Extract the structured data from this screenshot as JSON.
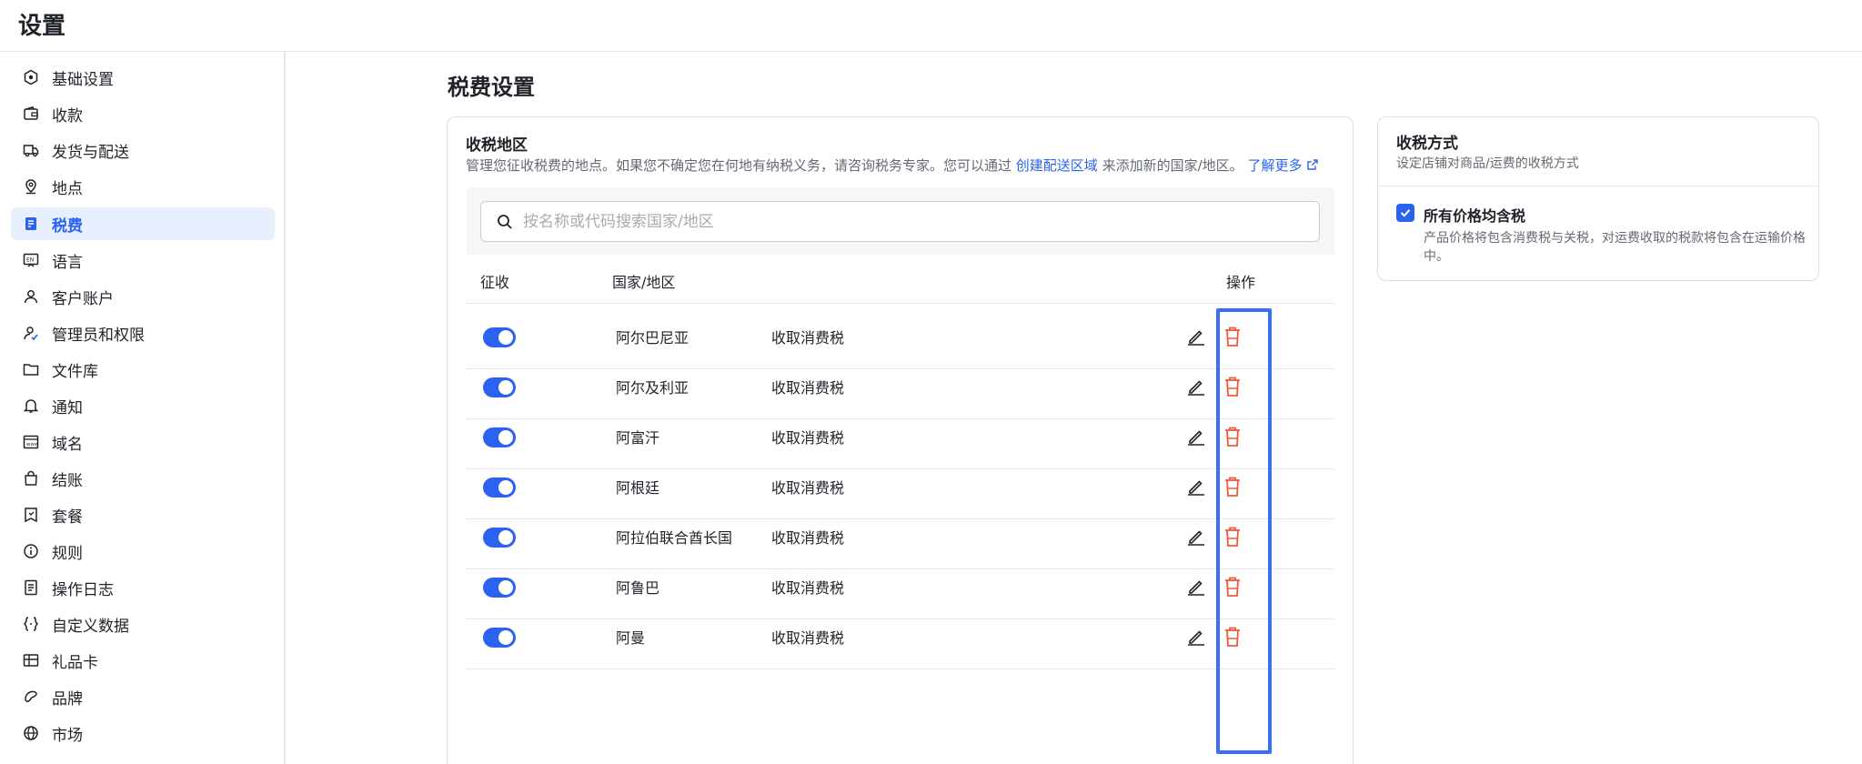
{
  "header": {
    "title": "设置"
  },
  "sidebar": {
    "items": [
      {
        "label": "基础设置",
        "icon": "hexagon-icon"
      },
      {
        "label": "收款",
        "icon": "wallet-icon"
      },
      {
        "label": "发货与配送",
        "icon": "truck-icon"
      },
      {
        "label": "地点",
        "icon": "location-pin-icon"
      },
      {
        "label": "税费",
        "icon": "tax-receipt-icon",
        "active": true
      },
      {
        "label": "语言",
        "icon": "language-icon"
      },
      {
        "label": "客户账户",
        "icon": "user-icon"
      },
      {
        "label": "管理员和权限",
        "icon": "user-permission-icon"
      },
      {
        "label": "文件库",
        "icon": "folder-icon"
      },
      {
        "label": "通知",
        "icon": "bell-icon"
      },
      {
        "label": "域名",
        "icon": "domain-icon"
      },
      {
        "label": "结账",
        "icon": "shopping-bag-icon"
      },
      {
        "label": "套餐",
        "icon": "plan-icon"
      },
      {
        "label": "规则",
        "icon": "info-icon"
      },
      {
        "label": "操作日志",
        "icon": "log-icon"
      },
      {
        "label": "自定义数据",
        "icon": "braces-icon"
      },
      {
        "label": "礼品卡",
        "icon": "gift-card-icon"
      },
      {
        "label": "品牌",
        "icon": "brand-icon"
      },
      {
        "label": "市场",
        "icon": "globe-icon"
      }
    ]
  },
  "main": {
    "page_title": "税费设置",
    "tax_regions": {
      "title": "收税地区",
      "description_pre": "管理您征收税费的地点。如果您不确定您在何地有纳税义务，请咨询税务专家。您可以通过",
      "description_link": "创建配送区域",
      "description_post": "来添加新的国家/地区。",
      "learn_more": "了解更多",
      "search_placeholder": "按名称或代码搜索国家/地区",
      "columns": {
        "collect": "征收",
        "country": "国家/地区",
        "actions": "操作"
      },
      "rows": [
        {
          "country": "阿尔巴尼亚",
          "tax": "收取消费税",
          "enabled": true
        },
        {
          "country": "阿尔及利亚",
          "tax": "收取消费税",
          "enabled": true
        },
        {
          "country": "阿富汗",
          "tax": "收取消费税",
          "enabled": true
        },
        {
          "country": "阿根廷",
          "tax": "收取消费税",
          "enabled": true
        },
        {
          "country": "阿拉伯联合酋长国",
          "tax": "收取消费税",
          "enabled": true
        },
        {
          "country": "阿鲁巴",
          "tax": "收取消费税",
          "enabled": true
        },
        {
          "country": "阿曼",
          "tax": "收取消费税",
          "enabled": true
        }
      ]
    },
    "tax_method": {
      "title": "收税方式",
      "description": "设定店铺对商品/运费的收税方式",
      "checkbox_label": "所有价格均含税",
      "checkbox_checked": true,
      "checkbox_desc": "产品价格将包含消费税与关税，对运费收取的税款将包含在运输价格中。"
    }
  },
  "colors": {
    "accent": "#2b63f0",
    "danger": "#f05a3b",
    "highlight": "#3a6ff0"
  }
}
